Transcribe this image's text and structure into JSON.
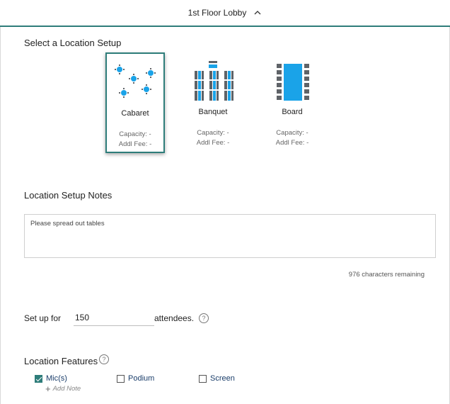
{
  "header": {
    "title": "1st Floor Lobby"
  },
  "setup_section": {
    "title": "Select a Location Setup"
  },
  "setups": [
    {
      "name": "Cabaret",
      "capacity": "Capacity: -",
      "fee": "Addl Fee: -",
      "selected": true,
      "icon": "cabaret-tables-icon"
    },
    {
      "name": "Banquet",
      "capacity": "Capacity: -",
      "fee": "Addl Fee: -",
      "selected": false,
      "icon": "banquet-tables-icon"
    },
    {
      "name": "Board",
      "capacity": "Capacity: -",
      "fee": "Addl Fee: -",
      "selected": false,
      "icon": "boardroom-table-icon"
    }
  ],
  "notes": {
    "title": "Location Setup Notes",
    "value": "Please spread out tables",
    "remaining": "976 characters remaining"
  },
  "attendees": {
    "prefix": "Set up for",
    "value": "150",
    "suffix": "attendees."
  },
  "features": {
    "title": "Location Features",
    "items": [
      {
        "label": "Mic(s)",
        "checked": true
      },
      {
        "label": "Podium",
        "checked": false
      },
      {
        "label": "Screen",
        "checked": false
      }
    ],
    "add_note": "Add Note"
  },
  "colors": {
    "accent": "#2e7d7a",
    "table_blue": "#1aa3e8",
    "chair_gray": "#5f6368"
  }
}
